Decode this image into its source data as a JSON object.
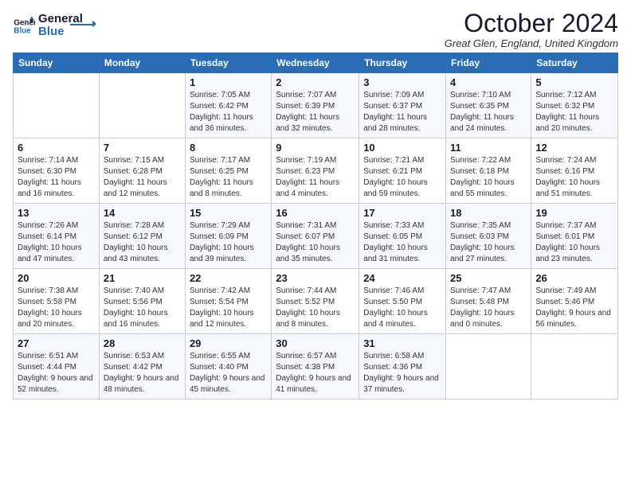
{
  "logo": {
    "line1": "General",
    "line2": "Blue"
  },
  "title": "October 2024",
  "location": "Great Glen, England, United Kingdom",
  "days_header": [
    "Sunday",
    "Monday",
    "Tuesday",
    "Wednesday",
    "Thursday",
    "Friday",
    "Saturday"
  ],
  "weeks": [
    [
      {
        "num": "",
        "info": ""
      },
      {
        "num": "",
        "info": ""
      },
      {
        "num": "1",
        "info": "Sunrise: 7:05 AM\nSunset: 6:42 PM\nDaylight: 11 hours and 36 minutes."
      },
      {
        "num": "2",
        "info": "Sunrise: 7:07 AM\nSunset: 6:39 PM\nDaylight: 11 hours and 32 minutes."
      },
      {
        "num": "3",
        "info": "Sunrise: 7:09 AM\nSunset: 6:37 PM\nDaylight: 11 hours and 28 minutes."
      },
      {
        "num": "4",
        "info": "Sunrise: 7:10 AM\nSunset: 6:35 PM\nDaylight: 11 hours and 24 minutes."
      },
      {
        "num": "5",
        "info": "Sunrise: 7:12 AM\nSunset: 6:32 PM\nDaylight: 11 hours and 20 minutes."
      }
    ],
    [
      {
        "num": "6",
        "info": "Sunrise: 7:14 AM\nSunset: 6:30 PM\nDaylight: 11 hours and 16 minutes."
      },
      {
        "num": "7",
        "info": "Sunrise: 7:15 AM\nSunset: 6:28 PM\nDaylight: 11 hours and 12 minutes."
      },
      {
        "num": "8",
        "info": "Sunrise: 7:17 AM\nSunset: 6:25 PM\nDaylight: 11 hours and 8 minutes."
      },
      {
        "num": "9",
        "info": "Sunrise: 7:19 AM\nSunset: 6:23 PM\nDaylight: 11 hours and 4 minutes."
      },
      {
        "num": "10",
        "info": "Sunrise: 7:21 AM\nSunset: 6:21 PM\nDaylight: 10 hours and 59 minutes."
      },
      {
        "num": "11",
        "info": "Sunrise: 7:22 AM\nSunset: 6:18 PM\nDaylight: 10 hours and 55 minutes."
      },
      {
        "num": "12",
        "info": "Sunrise: 7:24 AM\nSunset: 6:16 PM\nDaylight: 10 hours and 51 minutes."
      }
    ],
    [
      {
        "num": "13",
        "info": "Sunrise: 7:26 AM\nSunset: 6:14 PM\nDaylight: 10 hours and 47 minutes."
      },
      {
        "num": "14",
        "info": "Sunrise: 7:28 AM\nSunset: 6:12 PM\nDaylight: 10 hours and 43 minutes."
      },
      {
        "num": "15",
        "info": "Sunrise: 7:29 AM\nSunset: 6:09 PM\nDaylight: 10 hours and 39 minutes."
      },
      {
        "num": "16",
        "info": "Sunrise: 7:31 AM\nSunset: 6:07 PM\nDaylight: 10 hours and 35 minutes."
      },
      {
        "num": "17",
        "info": "Sunrise: 7:33 AM\nSunset: 6:05 PM\nDaylight: 10 hours and 31 minutes."
      },
      {
        "num": "18",
        "info": "Sunrise: 7:35 AM\nSunset: 6:03 PM\nDaylight: 10 hours and 27 minutes."
      },
      {
        "num": "19",
        "info": "Sunrise: 7:37 AM\nSunset: 6:01 PM\nDaylight: 10 hours and 23 minutes."
      }
    ],
    [
      {
        "num": "20",
        "info": "Sunrise: 7:38 AM\nSunset: 5:58 PM\nDaylight: 10 hours and 20 minutes."
      },
      {
        "num": "21",
        "info": "Sunrise: 7:40 AM\nSunset: 5:56 PM\nDaylight: 10 hours and 16 minutes."
      },
      {
        "num": "22",
        "info": "Sunrise: 7:42 AM\nSunset: 5:54 PM\nDaylight: 10 hours and 12 minutes."
      },
      {
        "num": "23",
        "info": "Sunrise: 7:44 AM\nSunset: 5:52 PM\nDaylight: 10 hours and 8 minutes."
      },
      {
        "num": "24",
        "info": "Sunrise: 7:46 AM\nSunset: 5:50 PM\nDaylight: 10 hours and 4 minutes."
      },
      {
        "num": "25",
        "info": "Sunrise: 7:47 AM\nSunset: 5:48 PM\nDaylight: 10 hours and 0 minutes."
      },
      {
        "num": "26",
        "info": "Sunrise: 7:49 AM\nSunset: 5:46 PM\nDaylight: 9 hours and 56 minutes."
      }
    ],
    [
      {
        "num": "27",
        "info": "Sunrise: 6:51 AM\nSunset: 4:44 PM\nDaylight: 9 hours and 52 minutes."
      },
      {
        "num": "28",
        "info": "Sunrise: 6:53 AM\nSunset: 4:42 PM\nDaylight: 9 hours and 48 minutes."
      },
      {
        "num": "29",
        "info": "Sunrise: 6:55 AM\nSunset: 4:40 PM\nDaylight: 9 hours and 45 minutes."
      },
      {
        "num": "30",
        "info": "Sunrise: 6:57 AM\nSunset: 4:38 PM\nDaylight: 9 hours and 41 minutes."
      },
      {
        "num": "31",
        "info": "Sunrise: 6:58 AM\nSunset: 4:36 PM\nDaylight: 9 hours and 37 minutes."
      },
      {
        "num": "",
        "info": ""
      },
      {
        "num": "",
        "info": ""
      }
    ]
  ]
}
